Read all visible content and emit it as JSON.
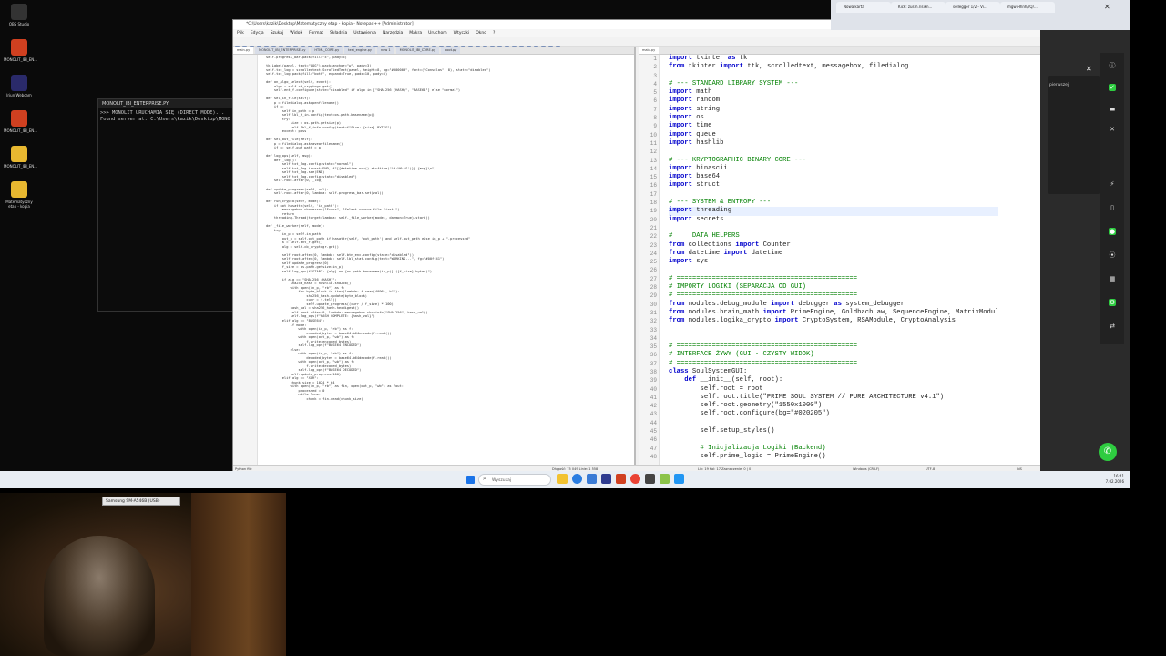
{
  "desktop": {
    "icons": [
      {
        "label": "OBS Studio",
        "icon": "obs-icon",
        "color": "#333333"
      },
      {
        "label": "MONOLIT_IBI_EN...",
        "icon": "rubik-cube-icon",
        "color": "#d04020"
      },
      {
        "label": "Iriun Webcam",
        "icon": "webcam-icon",
        "color": "#2a2a6a"
      },
      {
        "label": "MONOLIT_IBI_EN...",
        "icon": "rubik-cube-icon",
        "color": "#d04020"
      },
      {
        "label": "MONOLIT_IBI_EN...",
        "icon": "folder-icon",
        "color": "#e8b830"
      },
      {
        "label": "Matematyczny etap - kopia",
        "icon": "folder-icon",
        "color": "#e8b830"
      }
    ]
  },
  "console": {
    "title": "MONOLIT_IBI_ENTERPRISE.PY",
    "lines": [
      ">>> MONOLIT URUCHAMIA SIĘ (DIRECT MODE)...",
      "Found server at: C:\\Users\\kazik\\Desktop\\MONO"
    ]
  },
  "editor": {
    "title": "*C:\\Users\\kazik\\Desktop\\Matematyczny etap - kopia - Notepad++ [Administrator]",
    "menu": [
      "Plik",
      "Edycja",
      "Szukaj",
      "Widok",
      "Format",
      "Składnia",
      "Ustawienia",
      "Narzędzia",
      "Makra",
      "Uruchom",
      "Wtyczki",
      "Okno",
      "?"
    ],
    "left_tabs": [
      "main.py",
      "MONOLIT_IBI_ENTERPRISE.py",
      "HTML_CORE.py",
      "test_engine.py",
      "new 1",
      "MONOLIT_IBI_CORE.py",
      "boot.py"
    ],
    "right_tabs": [
      "main.py"
    ],
    "left_code": [
      "self.progress_bar.pack(fill=\"x\", pady=5)",
      "",
      "tk.Label(panel, text=\"LOG\").pack(anchor=\"w\", pady=3)",
      "self.txt_log = scrolledtext.ScrolledText(panel, height=8, bg=\"#000000\", font=(\"Consolas\", 8), state=\"disabled\")",
      "self.txt_log.pack(fill=\"both\", expand=True, padx=10, pady=5)",
      "",
      "def on_algo_select(self, event):",
      "    algo = self.cb_cryptogr.get()",
      "    self.ent_f.configure(state=\"disabled\" if algo in [\"SHA-256 (HASH)\", \"BASE64\"] else \"normal\")",
      "",
      "def sel_in_file(self):",
      "    p = filedialog.askopenfilename()",
      "    if p:",
      "        self.in_path = p",
      "        self.lbl_f_in.config(text=os.path.basename(p))",
      "        try:",
      "            size = os.path.getsize(p)",
      "            self.lbl_f_info.config(text=f\"Size: {size} BYTES\")",
      "        except: pass",
      "",
      "def sel_out_file(self):",
      "    p = filedialog.asksaveasfilename()",
      "    if p: self.out_path = p",
      "",
      "def log_ops(self, msg):",
      "    def _log():",
      "        self.txt_log.config(state=\"normal\")",
      "        self.txt_log.insert(END, f\"[{datetime.now().strftime('%H:%M:%S')}] {msg}\\n\")",
      "        self.txt_log.see(END)",
      "        self.txt_log.config(state=\"disabled\")",
      "    self.root.after(0, _log)",
      "",
      "def update_progress(self, val):",
      "    self.root.after(0, lambda: self.progress_bar.set(val))",
      "",
      "def run_crypto(self, mode):",
      "    if not hasattr(self, 'in_path'):",
      "        messagebox.showerror(\"Error\", \"Select source file first.\")",
      "        return",
      "    threading.Thread(target=lambda: self._file_worker(mode), daemon=True).start()",
      "",
      "def _file_worker(self, mode):",
      "    try:",
      "        in_p = self.in_path",
      "        out_p = self.out_path if hasattr(self, 'out_path') and self.out_path else in_p + \".processed\"",
      "        k = self.ent_f.get()",
      "        alg = self.cb_cryptogr.get()",
      "",
      "        self.root.after(0, lambda: self.btn_enc.config(state=\"disabled\"))",
      "        self.root.after(0, lambda: self.lbl_stat.config(text=\"WORKING...\", fg=\"#00ff41\"))",
      "        self.update_progress(0)",
      "        f_size = os.path.getsize(in_p)",
      "        self.log_ops(f\"START: {alg} on {os.path.basename(in_p)} ({f_size} bytes)\")",
      "",
      "        if alg == \"SHA-256 (HASH)\":",
      "            sha256_hash = hashlib.sha256()",
      "            with open(in_p, \"rb\") as f:",
      "                for byte_block in iter(lambda: f.read(4096), b\"\"):",
      "                    sha256_hash.update(byte_block)",
      "                    curr = f.tell()",
      "                    self.update_progress((curr / f_size) * 100)",
      "            hash_val = sha256_hash.hexdigest()",
      "            self.root.after(0, lambda: messagebox.showinfo(\"SHA-256\", hash_val))",
      "            self.log_ops(f\"HASH COMPLETE: {hash_val}\")",
      "        elif alg == \"BASE64\":",
      "            if mode:",
      "                with open(in_p, \"rb\") as f:",
      "                    encoded_bytes = base64.b64encode(f.read())",
      "                with open(out_p, \"wb\") as f:",
      "                    f.write(encoded_bytes)",
      "                self.log_ops(f\"BASE64 ENCODED\")",
      "            else:",
      "                with open(in_p, \"rb\") as f:",
      "                    decoded_bytes = base64.b64decode(f.read())",
      "                with open(out_p, \"wb\") as f:",
      "                    f.write(decoded_bytes)",
      "                self.log_ops(f\"BASE64 DECODED\")",
      "            self.update_progress(100)",
      "        elif alg == \"XOR\":",
      "            chunk_size = 1024 * 64",
      "            with open(in_p, \"rb\") as fin, open(out_p, \"wb\") as fout:",
      "                processed = 0",
      "                while True:",
      "                    chunk = fin.read(chunk_size)"
    ],
    "right_code": [
      {
        "n": "1",
        "t": "import tkinter as tk"
      },
      {
        "n": "2",
        "t": "from tkinter import ttk, scrolledtext, messagebox, filedialog"
      },
      {
        "n": "3",
        "t": ""
      },
      {
        "n": "4",
        "t": "# --- STANDARD LIBRARY SYSTEM ---"
      },
      {
        "n": "5",
        "t": "import math"
      },
      {
        "n": "6",
        "t": "import random"
      },
      {
        "n": "7",
        "t": "import string"
      },
      {
        "n": "8",
        "t": "import os"
      },
      {
        "n": "9",
        "t": "import time"
      },
      {
        "n": "10",
        "t": "import queue"
      },
      {
        "n": "11",
        "t": "import hashlib"
      },
      {
        "n": "12",
        "t": ""
      },
      {
        "n": "13",
        "t": "# --- KRYPTOGRAPHIC BINARY CORE ---"
      },
      {
        "n": "14",
        "t": "import binascii"
      },
      {
        "n": "15",
        "t": "import base64"
      },
      {
        "n": "16",
        "t": "import struct"
      },
      {
        "n": "17",
        "t": ""
      },
      {
        "n": "18",
        "t": "# --- SYSTEM & ENTROPY ---"
      },
      {
        "n": "19",
        "t": "import threading"
      },
      {
        "n": "20",
        "t": "import secrets"
      },
      {
        "n": "21",
        "t": ""
      },
      {
        "n": "22",
        "t": "#     DATA HELPERS"
      },
      {
        "n": "23",
        "t": "from collections import Counter"
      },
      {
        "n": "24",
        "t": "from datetime import datetime"
      },
      {
        "n": "25",
        "t": "import sys"
      },
      {
        "n": "26",
        "t": ""
      },
      {
        "n": "27",
        "t": "# =============================================="
      },
      {
        "n": "28",
        "t": "# IMPORTY LOGIKI (SEPARACJA OD GUI)"
      },
      {
        "n": "29",
        "t": "# =============================================="
      },
      {
        "n": "30",
        "t": "from modules.debug_module import debugger as system_debugger"
      },
      {
        "n": "31",
        "t": "from modules.brain_math import PrimeEngine, GoldbachLaw, SequenceEngine, MatrixModul"
      },
      {
        "n": "32",
        "t": "from modules.logika_crypto import CryptoSystem, RSAModule, CryptoAnalysis"
      },
      {
        "n": "33",
        "t": ""
      },
      {
        "n": "34",
        "t": ""
      },
      {
        "n": "35",
        "t": "# =============================================="
      },
      {
        "n": "36",
        "t": "# INTERFACE ŻYWY (GUI - CZYSTY WIDOK)"
      },
      {
        "n": "37",
        "t": "# =============================================="
      },
      {
        "n": "38",
        "t": "class SoulSystemGUI:"
      },
      {
        "n": "39",
        "t": "    def __init__(self, root):"
      },
      {
        "n": "40",
        "t": "        self.root = root"
      },
      {
        "n": "41",
        "t": "        self.root.title(\"PRIME SOUL SYSTEM // PURE ARCHITECTURE v4.1\")"
      },
      {
        "n": "42",
        "t": "        self.root.geometry(\"1550x1000\")"
      },
      {
        "n": "43",
        "t": "        self.root.configure(bg=\"#020205\")"
      },
      {
        "n": "44",
        "t": ""
      },
      {
        "n": "45",
        "t": "        self.setup_styles()"
      },
      {
        "n": "46",
        "t": ""
      },
      {
        "n": "47",
        "t": "        # Inicjalizacja Logiki (Backend)"
      },
      {
        "n": "48",
        "t": "        self.prime_logic = PrimeEngine()"
      }
    ],
    "highlight_line": "19",
    "status": {
      "left": "Python file",
      "length": "Długość: 75 049    Linie: 1 558",
      "pos": "Lin: 19    Kol: 17    Zaznaczenie: 0 | 0",
      "eol": "Windows (CR LF)",
      "enc": "UTF-8",
      "mode": "INS"
    }
  },
  "browser": {
    "tabs": [
      "Nowa karta",
      "Kick: zusm.risikn...",
      "sellegger 1/2 - Vi...",
      "mgwiHhnh/rQ/..."
    ],
    "side_label": "pierwszej"
  },
  "taskbar": {
    "search_placeholder": "Wyszukaj",
    "time": "16:41",
    "date": "7.02.2026"
  },
  "webcam": {
    "label": "Samsung SM-A546B (USB)"
  }
}
